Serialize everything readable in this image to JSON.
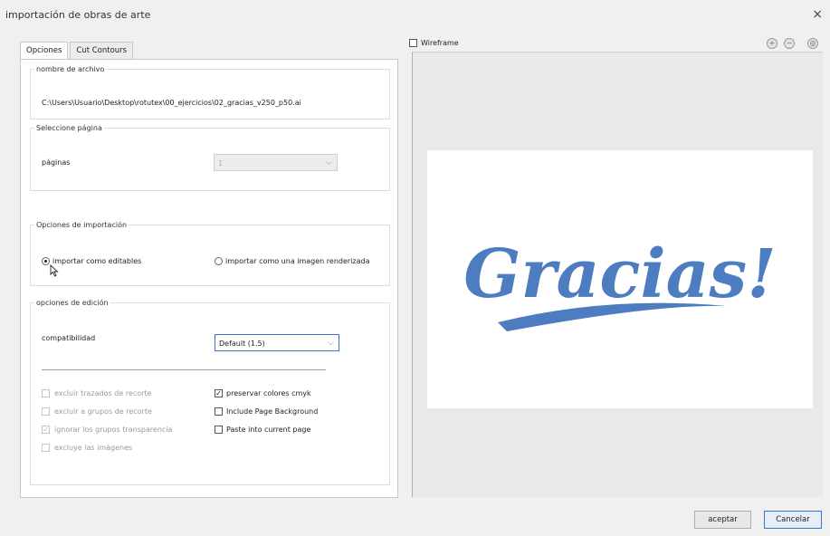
{
  "window": {
    "title": "importación de obras de arte",
    "close": "×"
  },
  "tabs": [
    "Opciones",
    "Cut Contours"
  ],
  "file": {
    "legend": "nombre de archivo",
    "path": "C:\\Users\\Usuario\\Desktop\\rotutex\\00_ejercicios\\02_gracias_v250_p50.ai"
  },
  "page_select": {
    "legend": "Seleccione página",
    "label": "páginas",
    "value": "1"
  },
  "import_options": {
    "legend": "Opciones de importación",
    "editable": "importar como editables",
    "rendered": "importar como una imagen renderizada",
    "selected": "editable"
  },
  "edit_options": {
    "legend": "opciones de edición",
    "compat_label": "compatibilidad",
    "compat_value": "Default (1.5)",
    "left_checks": [
      {
        "label": "excluir trazados de recorte",
        "checked": false,
        "disabled": true
      },
      {
        "label": "excluir a grupos de recorte",
        "checked": false,
        "disabled": true
      },
      {
        "label": "ignorar los grupos transparencia",
        "checked": true,
        "disabled": true
      },
      {
        "label": "excluye las imágenes",
        "checked": false,
        "disabled": true
      }
    ],
    "right_checks": [
      {
        "label": "preservar colores cmyk",
        "checked": true,
        "disabled": false
      },
      {
        "label": "Include Page Background",
        "checked": false,
        "disabled": false
      },
      {
        "label": "Paste into current page",
        "checked": false,
        "disabled": false
      }
    ]
  },
  "preview": {
    "wireframe_label": "Wireframe",
    "wireframe_checked": false,
    "artwork_text": "Gracias!",
    "artwork_color": "#4d7cc0"
  },
  "buttons": {
    "ok": "aceptar",
    "cancel": "Cancelar"
  }
}
